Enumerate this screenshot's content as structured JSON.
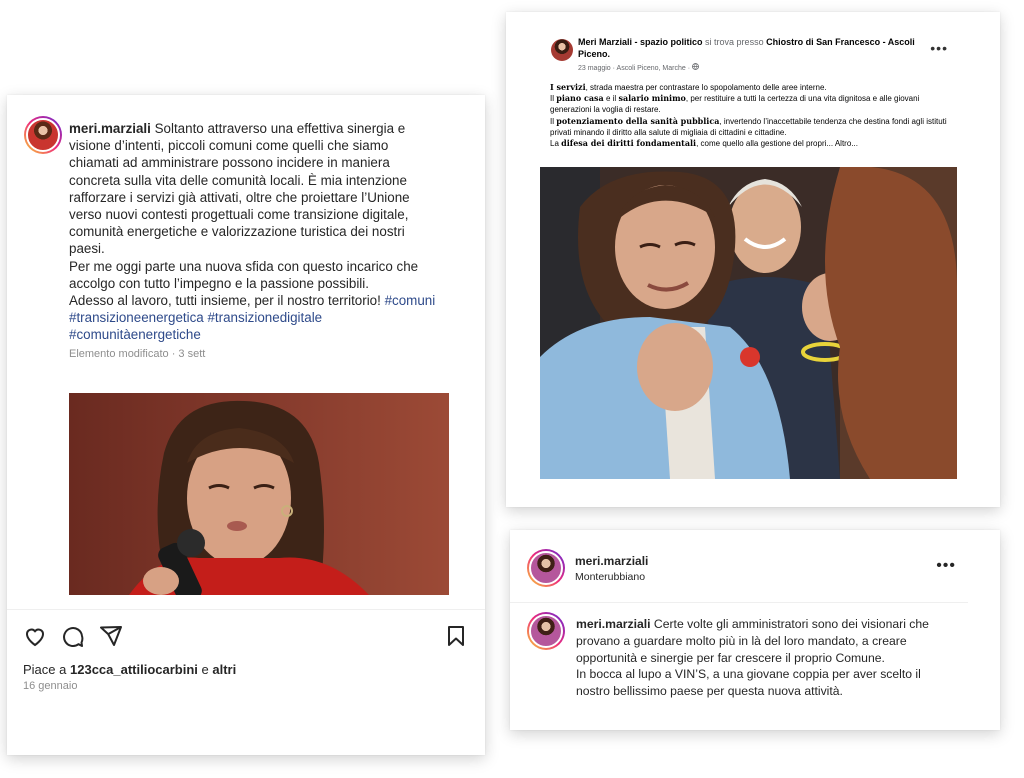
{
  "post_left": {
    "username": "meri.marziali",
    "caption_lines": [
      "Soltanto attraverso una effettiva sinergia e",
      "visione d’intenti, piccoli comuni come quelli che siamo",
      "chiamati ad amministrare possono incidere in maniera",
      "concreta sulla vita delle comunità locali. È mia intenzione",
      "rafforzare i servizi già attivati, oltre che proiettare l’Unione",
      "verso nuovi contesti progettuali come transizione digitale,",
      "comunità energetiche e valorizzazione turistica dei nostri",
      "paesi.",
      "Per me oggi parte una nuova sfida con questo incarico che",
      "accolgo con tutto l’impegno e la passione possibili.",
      "Adesso al lavoro, tutti insieme, per il nostro territorio!"
    ],
    "hashtag_1": "#comuni",
    "hashtag_2": "#transizioneenergetica",
    "hashtag_3": "#transizionedigitale",
    "hashtag_4": "#comunitàenergetiche",
    "meta": "Elemento modificato · 3 sett",
    "likes_prefix": "Piace a",
    "likes_user": "123cca_attiliocarbini",
    "likes_and": "e",
    "likes_others": "altri",
    "date": "16 gennaio",
    "icons": [
      "heart-icon",
      "comment-icon",
      "share-icon",
      "bookmark-icon"
    ]
  },
  "post_fb": {
    "author": "Meri Marziali - spazio politico",
    "at_text": "si trova presso",
    "place": "Chiostro di San Francesco - Ascoli Piceno.",
    "subline": "23 maggio · Ascoli Piceno, Marche ·",
    "p1_bold": "I servizi",
    "p1_rest": ", strada maestra per contrastare lo spopolamento delle aree interne.",
    "p2_a": "Il",
    "p2_bold1": "piano casa",
    "p2_b": "e il",
    "p2_bold2": "salario minimo",
    "p2_c": ", per restituire a tutti la certezza di una vita dignitosa e alle giovani generazioni la voglia di restare.",
    "p3_a": "Il",
    "p3_bold": "potenziamento della sanità pubblica",
    "p3_c": ", invertendo l’inaccettabile tendenza che destina fondi agli istituti privati minando il diritto alla salute di migliaia di cittadini e cittadine.",
    "p4_a": "La",
    "p4_bold": "difesa dei diritti fondamentali",
    "p4_c": ", come quello alla gestione del propri... Altro...",
    "more_icon": "more-horizontal-icon"
  },
  "post_right": {
    "username": "meri.marziali",
    "location": "Monterubbiano",
    "caption_lines": [
      "Certe volte gli amministratori sono dei visionari che",
      "provano a guardare molto più in là del loro mandato, a creare",
      "opportunità e sinergie per far crescere il proprio Comune.",
      "In bocca al lupo a VIN’S, a una giovane coppia per aver scelto il",
      "nostro bellissimo paese per questa nuova attività."
    ]
  }
}
